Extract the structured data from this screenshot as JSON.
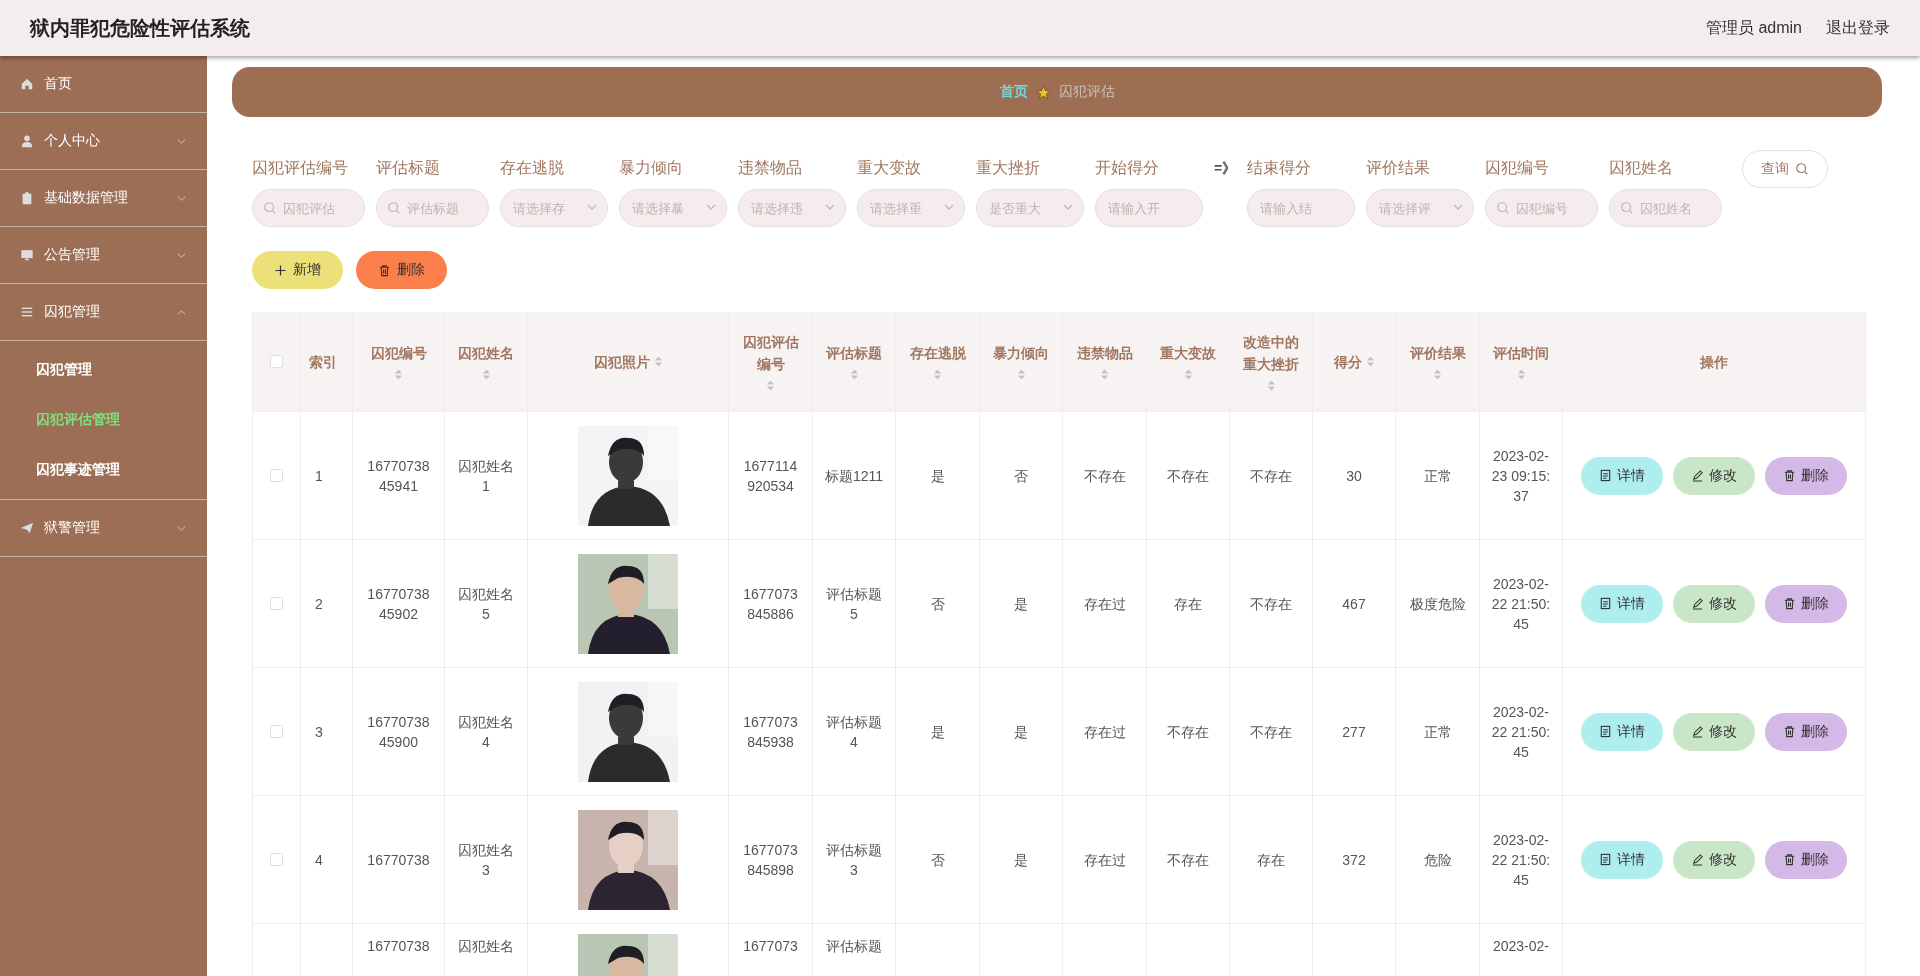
{
  "header": {
    "title": "狱内罪犯危险性评估系统",
    "user": "管理员 admin",
    "logout": "退出登录"
  },
  "sidebar": {
    "items": [
      {
        "label": "首页",
        "kind": "link"
      },
      {
        "label": "个人中心",
        "kind": "menu",
        "expanded": false
      },
      {
        "label": "基础数据管理",
        "kind": "menu",
        "expanded": false
      },
      {
        "label": "公告管理",
        "kind": "menu",
        "expanded": false
      },
      {
        "label": "囚犯管理",
        "kind": "menu",
        "expanded": true,
        "children": [
          {
            "label": "囚犯管理",
            "selected": false
          },
          {
            "label": "囚犯评估管理",
            "selected": true
          },
          {
            "label": "囚犯事迹管理",
            "selected": false
          }
        ]
      },
      {
        "label": "狱警管理",
        "kind": "menu",
        "expanded": false
      }
    ]
  },
  "breadcrumb": [
    {
      "label": "首页",
      "kind": "link"
    },
    {
      "label": "囚犯评估",
      "kind": "current"
    }
  ],
  "filters": [
    {
      "kind": "search",
      "label": "囚犯评估编号",
      "placeholder": "囚犯评估"
    },
    {
      "kind": "search",
      "label": "评估标题",
      "placeholder": "评估标题"
    },
    {
      "kind": "select",
      "label": "存在逃脱",
      "placeholder": "请选择存"
    },
    {
      "kind": "select",
      "label": "暴力倾向",
      "placeholder": "请选择暴"
    },
    {
      "kind": "select",
      "label": "违禁物品",
      "placeholder": "请选择违"
    },
    {
      "kind": "select",
      "label": "重大变故",
      "placeholder": "请选择重"
    },
    {
      "kind": "select",
      "label": "重大挫折",
      "placeholder": "是否重大"
    },
    {
      "kind": "input",
      "label": "开始得分",
      "placeholder": "请输入开"
    },
    {
      "kind": "separator",
      "text": "=》"
    },
    {
      "kind": "input",
      "label": "结束得分",
      "placeholder": "请输入结"
    },
    {
      "kind": "select",
      "label": "评价结果",
      "placeholder": "请选择评"
    },
    {
      "kind": "search",
      "label": "囚犯编号",
      "placeholder": "囚犯编号"
    },
    {
      "kind": "search",
      "label": "囚犯姓名",
      "placeholder": "囚犯姓名"
    }
  ],
  "query_button": "查询",
  "toolbar": [
    {
      "kind": "add",
      "label": "新增"
    },
    {
      "kind": "delete",
      "label": "删除"
    }
  ],
  "table": {
    "header_checkbox": {
      "checked": false
    },
    "columns": [
      {
        "label": "索引",
        "sortable": false
      },
      {
        "label": "囚犯编号",
        "sortable": true
      },
      {
        "label": "囚犯姓名",
        "sortable": true
      },
      {
        "label": "囚犯照片",
        "sortable": true
      },
      {
        "label": "囚犯评估编号",
        "sortable": true
      },
      {
        "label": "评估标题",
        "sortable": true
      },
      {
        "label": "存在逃脱",
        "sortable": true
      },
      {
        "label": "暴力倾向",
        "sortable": true
      },
      {
        "label": "违禁物品",
        "sortable": true
      },
      {
        "label": "重大变故",
        "sortable": true
      },
      {
        "label": "改造中的重大挫折",
        "sortable": true
      },
      {
        "label": "得分",
        "sortable": true
      },
      {
        "label": "评价结果",
        "sortable": true
      },
      {
        "label": "评估时间",
        "sortable": true
      },
      {
        "label": "操作",
        "sortable": false
      }
    ],
    "rows": [
      {
        "checked": false,
        "cells": [
          "1",
          "1677073845941",
          "囚犯姓名1",
          {
            "kind": "picture"
          },
          "1677114920534",
          "标题1211",
          "是",
          "否",
          "不存在",
          "不存在",
          "不存在",
          "30",
          "正常",
          "2023-02-23 09:15:37"
        ],
        "actions": [
          {
            "kind": "detail",
            "label": "详情"
          },
          {
            "kind": "edit",
            "label": "修改"
          },
          {
            "kind": "delete",
            "label": "删除"
          }
        ]
      },
      {
        "checked": false,
        "cells": [
          "2",
          "1677073845902",
          "囚犯姓名5",
          {
            "kind": "picture"
          },
          "1677073845886",
          "评估标题5",
          "否",
          "是",
          "存在过",
          "存在",
          "不存在",
          "467",
          "极度危险",
          "2023-02-22 21:50:45"
        ],
        "actions": [
          {
            "kind": "detail",
            "label": "详情"
          },
          {
            "kind": "edit",
            "label": "修改"
          },
          {
            "kind": "delete",
            "label": "删除"
          }
        ]
      },
      {
        "checked": false,
        "cells": [
          "3",
          "1677073845900",
          "囚犯姓名4",
          {
            "kind": "picture"
          },
          "1677073845938",
          "评估标题4",
          "是",
          "是",
          "存在过",
          "不存在",
          "不存在",
          "277",
          "正常",
          "2023-02-22 21:50:45"
        ],
        "actions": [
          {
            "kind": "detail",
            "label": "详情"
          },
          {
            "kind": "edit",
            "label": "修改"
          },
          {
            "kind": "delete",
            "label": "删除"
          }
        ]
      },
      {
        "checked": false,
        "cells": [
          "4",
          "16770738",
          "囚犯姓名3",
          {
            "kind": "picture"
          },
          "1677073845898",
          "评估标题3",
          "否",
          "是",
          "存在过",
          "不存在",
          "存在",
          "372",
          "危险",
          "2023-02-22 21:50:45"
        ],
        "actions": [
          {
            "kind": "detail",
            "label": "详情"
          },
          {
            "kind": "edit",
            "label": "修改"
          },
          {
            "kind": "delete",
            "label": "删除"
          }
        ]
      },
      {
        "cells": [
          "",
          "16770738",
          "囚犯姓名",
          {
            "kind": "picture"
          },
          "1677073",
          "评估标题",
          "",
          "",
          "",
          "",
          "",
          "",
          "",
          "2023-02-"
        ]
      }
    ]
  }
}
